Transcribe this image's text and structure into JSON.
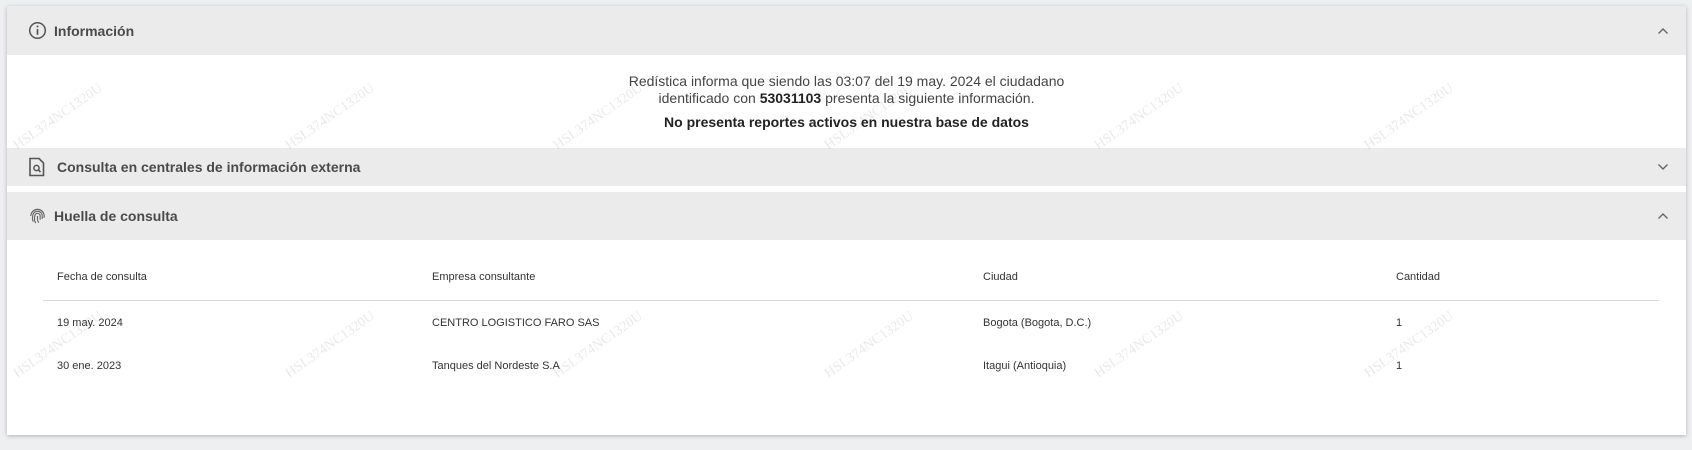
{
  "sections": {
    "informacion": {
      "title": "Información",
      "icon": "info-circle-icon",
      "expanded": true
    },
    "consulta_externa": {
      "title": "Consulta en centrales de información externa",
      "icon": "document-search-icon",
      "expanded": false
    },
    "huella": {
      "title": "Huella de consulta",
      "icon": "fingerprint-icon",
      "expanded": true
    }
  },
  "info": {
    "line1": "Redística informa que siendo las 03:07 del 19 may. 2024 el ciudadano",
    "line2_prefix": "identificado con ",
    "document_number": "53031103",
    "line2_suffix": " presenta la siguiente información.",
    "status": "No presenta reportes activos en nuestra base de datos"
  },
  "table": {
    "headers": [
      "Fecha de consulta",
      "Empresa consultante",
      "Ciudad",
      "Cantidad"
    ],
    "rows": [
      [
        "19 may. 2024",
        "CENTRO LOGISTICO FARO SAS",
        "Bogota (Bogota, D.C.)",
        "1"
      ],
      [
        "30 ene. 2023",
        "Tanques del Nordeste S.A",
        "Itagui (Antioquia)",
        "1"
      ]
    ]
  },
  "watermark": "HSL374NC1320U"
}
